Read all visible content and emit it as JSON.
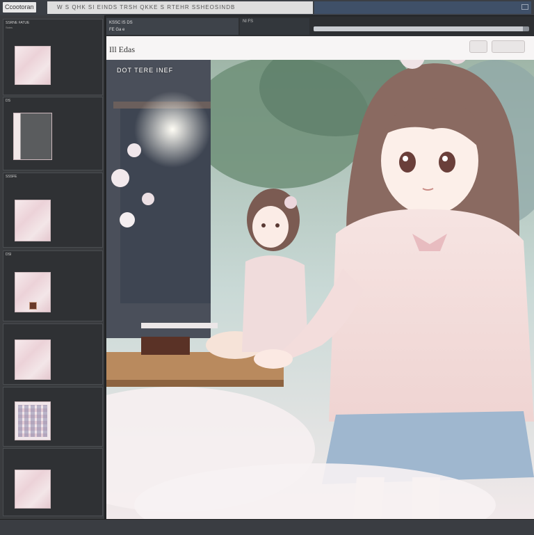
{
  "app": {
    "title": "Ccootoran",
    "address": "W S  QHK  SI  EINDS TRSH  QKKE  S  RTEHR  SSHEOSINDB"
  },
  "sidebar": {
    "items": [
      {
        "label": "SSRNE FATUE",
        "sub": "Sstes",
        "thumb": "pink"
      },
      {
        "label": "DS",
        "sub": "",
        "thumb": "dark"
      },
      {
        "label": "SSSFE",
        "sub": "",
        "thumb": "pink"
      },
      {
        "label": "DSI",
        "sub": "",
        "thumb": "pink"
      },
      {
        "label": "",
        "sub": "",
        "thumb": "pink"
      },
      {
        "label": "",
        "sub": "",
        "thumb": "grid"
      },
      {
        "label": "",
        "sub": "",
        "thumb": "pink"
      }
    ]
  },
  "viewer": {
    "tab_main": "KSSC IS DS",
    "tab_main_sub": "FE  Ga e",
    "tab_secondary": "Nl  FS",
    "progress": 0.97,
    "image_title": "Ill Edas",
    "image_caption": "DOT  TERE INEF"
  },
  "colors": {
    "accent": "#3f5068",
    "sidebar": "#3a3c3f",
    "canvas": "#f3eeee"
  }
}
